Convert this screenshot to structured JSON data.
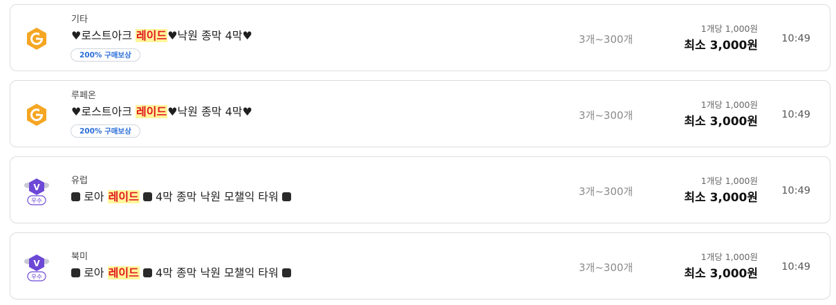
{
  "listings": [
    {
      "seller_icon": "g-badge-icon",
      "server": "기타",
      "title_prefix": "♥로스트아크 ",
      "title_highlight": "레이드",
      "title_suffix": "♥낙원 종막 4막♥",
      "badge": "200% 구매보상",
      "quantity": "3개~300개",
      "unit_price": "1개당 1,000원",
      "min_price": "최소 3,000원",
      "time": "10:49"
    },
    {
      "seller_icon": "g-badge-icon",
      "server": "루페온",
      "title_prefix": "♥로스트아크 ",
      "title_highlight": "레이드",
      "title_suffix": "♥낙원 종막 4막♥",
      "badge": "200% 구매보상",
      "quantity": "3개~300개",
      "unit_price": "1개당 1,000원",
      "min_price": "최소 3,000원",
      "time": "10:49"
    },
    {
      "seller_icon": "v-grade-icon",
      "seller_grade": "우수",
      "server": "유럽",
      "title_prefix": " 로아 ",
      "title_highlight": "레이드",
      "title_suffix": " 4막 종막 낙원 모챌익 타워 ",
      "quantity": "3개~300개",
      "unit_price": "1개당 1,000원",
      "min_price": "최소 3,000원",
      "time": "10:49"
    },
    {
      "seller_icon": "v-grade-icon",
      "seller_grade": "우수",
      "server": "북미",
      "title_prefix": " 로아 ",
      "title_highlight": "레이드",
      "title_suffix": " 4막 종막 낙원 모챌익 타워 ",
      "quantity": "3개~300개",
      "unit_price": "1개당 1,000원",
      "min_price": "최소 3,000원",
      "time": "10:49"
    }
  ],
  "colors": {
    "highlight_bg": "#fff59a",
    "highlight_text": "#e0161f",
    "badge_text": "#2a6ed8",
    "g_icon": "#f5a623",
    "v_icon": "#6d48d6"
  }
}
